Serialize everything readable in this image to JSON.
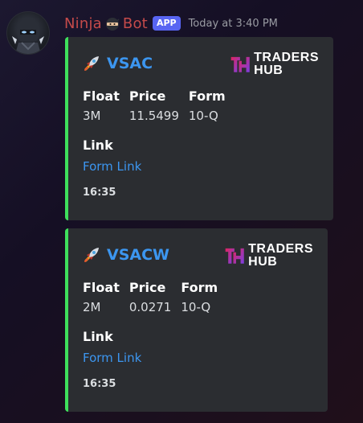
{
  "message": {
    "author": "Ninja",
    "author_suffix": "Bot",
    "badge": "APP",
    "timestamp": "Today at 3:40 PM",
    "author_color": "#c44a4a"
  },
  "embeds": [
    {
      "ticker": "VSAC",
      "accent_color": "#3ee05c",
      "fields": [
        {
          "name": "Float",
          "value": "3M"
        },
        {
          "name": "Price",
          "value": "11.5499"
        },
        {
          "name": "Form",
          "value": "10-Q"
        }
      ],
      "link_name": "Link",
      "link_text": "Form Link",
      "footer": "16:35",
      "logo_line1": "TRADERS",
      "logo_line2": "HUB"
    },
    {
      "ticker": "VSACW",
      "accent_color": "#3ee05c",
      "fields": [
        {
          "name": "Float",
          "value": "2M"
        },
        {
          "name": "Price",
          "value": "0.0271"
        },
        {
          "name": "Form",
          "value": "10-Q"
        }
      ],
      "link_name": "Link",
      "link_text": "Form Link",
      "footer": "16:35",
      "logo_line1": "TRADERS",
      "logo_line2": "HUB"
    }
  ]
}
